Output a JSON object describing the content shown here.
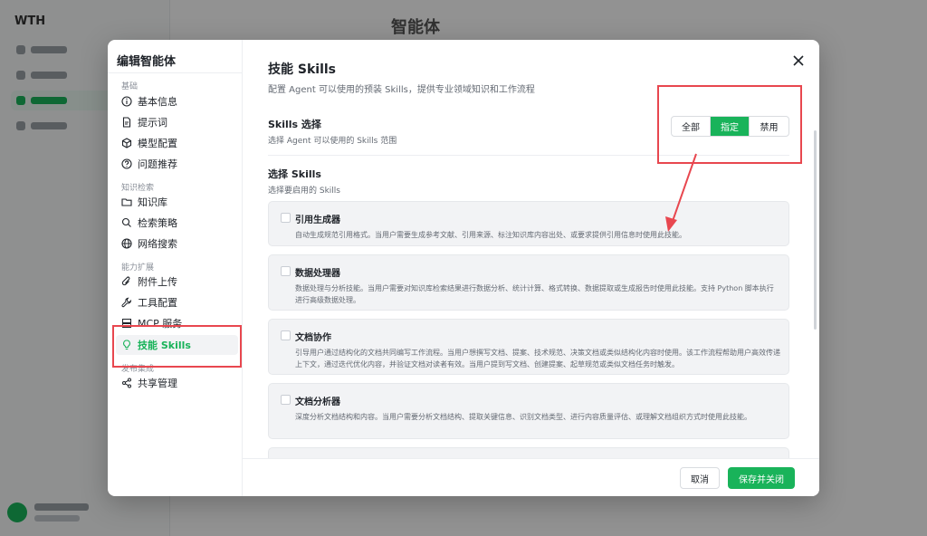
{
  "background": {
    "logo": "WTH",
    "title": "智能体",
    "nav_count": 4
  },
  "modal": {
    "title": "编辑智能体",
    "groups": [
      {
        "label": "基础",
        "items": [
          {
            "label": "基本信息",
            "icon": "info-icon"
          },
          {
            "label": "提示词",
            "icon": "document-icon"
          },
          {
            "label": "模型配置",
            "icon": "cube-icon"
          },
          {
            "label": "问题推荐",
            "icon": "question-icon"
          }
        ]
      },
      {
        "label": "知识检索",
        "items": [
          {
            "label": "知识库",
            "icon": "folder-icon"
          },
          {
            "label": "检索策略",
            "icon": "search-icon"
          },
          {
            "label": "网络搜索",
            "icon": "globe-icon"
          }
        ]
      },
      {
        "label": "能力扩展",
        "items": [
          {
            "label": "附件上传",
            "icon": "paperclip-icon"
          },
          {
            "label": "工具配置",
            "icon": "wrench-icon"
          },
          {
            "label": "MCP 服务",
            "icon": "server-icon"
          },
          {
            "label": "技能 Skills",
            "icon": "lightbulb-icon",
            "active": true
          }
        ]
      },
      {
        "label": "发布集成",
        "items": [
          {
            "label": "共享管理",
            "icon": "share-icon"
          }
        ]
      }
    ],
    "section_title": "技能 Skills",
    "section_desc": "配置 Agent 可以使用的预装 Skills，提供专业领域知识和工作流程",
    "selection": {
      "title": "Skills 选择",
      "desc": "选择 Agent 可以使用的 Skills 范围",
      "options": [
        "全部",
        "指定",
        "禁用"
      ],
      "selected": "指定"
    },
    "choose": {
      "title": "选择 Skills",
      "desc": "选择要启用的 Skills"
    },
    "skills": [
      {
        "name": "引用生成器",
        "desc": "自动生成规范引用格式。当用户需要生成参考文献、引用来源、标注知识库内容出处、或要求提供引用信息时使用此技能。",
        "checked": false
      },
      {
        "name": "数据处理器",
        "desc": "数据处理与分析技能。当用户需要对知识库检索结果进行数据分析、统计计算、格式转换、数据提取或生成报告时使用此技能。支持 Python 脚本执行进行高级数据处理。",
        "checked": false
      },
      {
        "name": "文档协作",
        "desc": "引导用户通过结构化的文档共同编写工作流程。当用户想撰写文档、提案、技术规范、决策文档或类似结构化内容时使用。该工作流程帮助用户高效传递上下文，通过迭代优化内容，并验证文档对读者有效。当用户提到写文档、创建提案、起草规范或类似文档任务时触发。",
        "checked": false
      },
      {
        "name": "文档分析器",
        "desc": "深度分析文档结构和内容。当用户需要分析文档结构、提取关键信息、识别文档类型、进行内容质量评估、或理解文档组织方式时使用此技能。",
        "checked": false
      }
    ],
    "footer": {
      "cancel": "取消",
      "save": "保存并关闭"
    }
  },
  "colors": {
    "accent": "#19b35a",
    "annotation": "#e8474f"
  }
}
